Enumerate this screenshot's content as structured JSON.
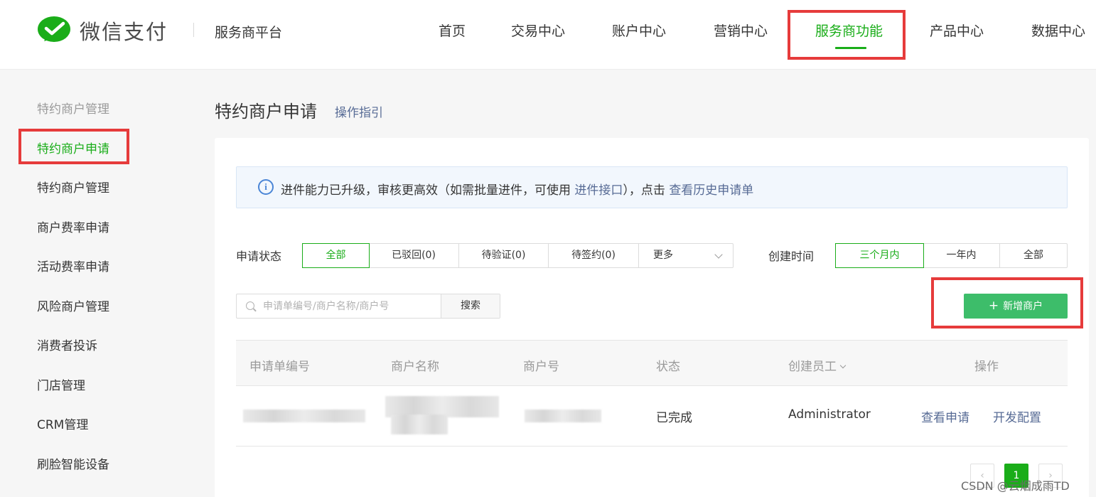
{
  "header": {
    "brand": "微信支付",
    "platform": "服务商平台",
    "nav": [
      "首页",
      "交易中心",
      "账户中心",
      "营销中心",
      "服务商功能",
      "产品中心",
      "数据中心"
    ],
    "active_nav": "服务商功能",
    "accent": "#1aad19"
  },
  "sidebar": {
    "title": "特约商户管理",
    "items": [
      {
        "label": "特约商户申请",
        "active": true
      },
      {
        "label": "特约商户管理"
      },
      {
        "label": "商户费率申请"
      },
      {
        "label": "活动费率申请"
      },
      {
        "label": "风险商户管理"
      },
      {
        "label": "消费者投诉"
      },
      {
        "label": "门店管理"
      },
      {
        "label": "CRM管理"
      },
      {
        "label": "刷脸智能设备"
      }
    ]
  },
  "page": {
    "title": "特约商户申请",
    "guide_link": "操作指引"
  },
  "notice": {
    "icon": "info-icon",
    "text_before": "进件能力已升级，审核更高效（如需批量进件，可使用 ",
    "link1": "进件接口",
    "text_middle": "），点击 ",
    "link2": "查看历史申请单"
  },
  "filters": {
    "status_label": "申请状态",
    "status_options": [
      "全部",
      "已驳回(0)",
      "待验证(0)",
      "待签约(0)"
    ],
    "status_selected": "全部",
    "more_label": "更多",
    "time_label": "创建时间",
    "time_options": [
      "三个月内",
      "一年内",
      "全部"
    ],
    "time_selected": "三个月内"
  },
  "search": {
    "placeholder": "申请单编号/商户名称/商户号",
    "button": "搜索"
  },
  "add_button": {
    "label": "新增商户",
    "color": "#3dbd6a"
  },
  "table": {
    "headers": [
      "申请单编号",
      "商户名称",
      "商户号",
      "状态",
      "创建员工",
      "操作"
    ],
    "rows": [
      {
        "status": "已完成",
        "creator": "Administrator",
        "actions": [
          "查看申请",
          "开发配置"
        ]
      }
    ]
  },
  "pagination": {
    "current": "1"
  },
  "watermark": "CSDN @云烟成雨TD",
  "annotation_color": "#e63b3b"
}
